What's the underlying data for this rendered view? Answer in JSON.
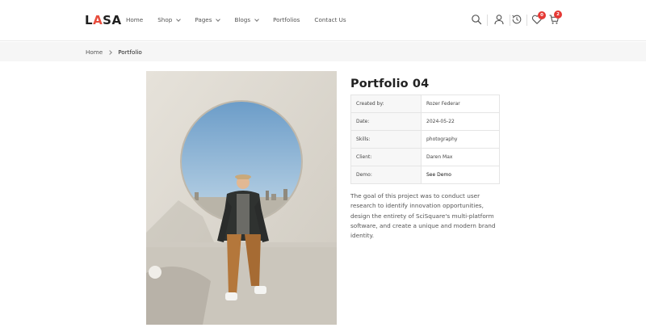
{
  "header": {
    "logo_prefix": "L",
    "logo_accent": "A",
    "logo_suffix": "SA",
    "nav": [
      {
        "label": "Home",
        "has_dropdown": false
      },
      {
        "label": "Shop",
        "has_dropdown": true
      },
      {
        "label": "Pages",
        "has_dropdown": true
      },
      {
        "label": "Blogs",
        "has_dropdown": true
      },
      {
        "label": "Portfolios",
        "has_dropdown": false
      },
      {
        "label": "Contact Us",
        "has_dropdown": false
      }
    ],
    "icons": [
      "search-icon",
      "user-icon",
      "history-icon",
      "heart-icon",
      "cart-icon"
    ],
    "wishlist_count": "0",
    "cart_count": "2",
    "accent_color": "#e74c3c",
    "badge_color": "#e53935"
  },
  "breadcrumb": {
    "home": "Home",
    "current": "Portfolio"
  },
  "portfolio": {
    "title": "Portfolio 04",
    "details": [
      {
        "label": "Created by:",
        "value": "Rozer Federar"
      },
      {
        "label": "Date:",
        "value": "2024-05-22"
      },
      {
        "label": "Skills:",
        "value": "photography"
      },
      {
        "label": "Client:",
        "value": "Daren Max"
      },
      {
        "label": "Demo:",
        "value": "See Demo"
      }
    ],
    "description": "The goal of this project was to conduct user research to identify innovation opportunities, design the entirety of SciSquare's multi-platform software, and create a unique and modern brand identity."
  }
}
